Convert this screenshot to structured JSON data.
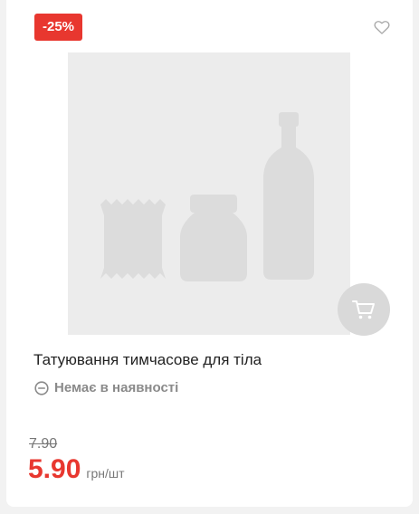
{
  "product": {
    "discount_badge": "-25%",
    "name": "Татуювання тимчасове для тіла",
    "stock_status": "Немає в наявності",
    "old_price": "7.90",
    "price": "5.90",
    "unit": "грн/шт"
  },
  "icons": {
    "favorite": "heart-outline-icon",
    "cart": "cart-icon",
    "stock": "minus-circle-icon",
    "placeholder": "grocery-placeholder-icon"
  },
  "colors": {
    "accent": "#e8372f",
    "muted": "#8a8a8a",
    "placeholder_bg": "#ececec",
    "placeholder_shape": "#dcdcdc"
  }
}
